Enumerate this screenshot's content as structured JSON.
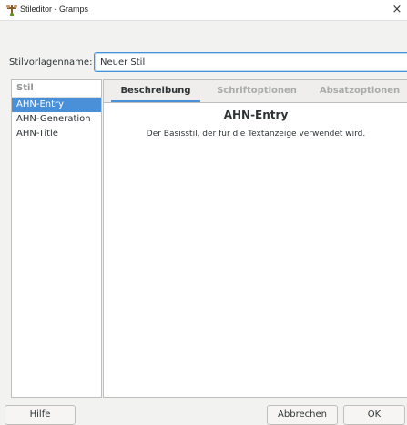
{
  "window": {
    "title": "Stileditor - Gramps",
    "close_glyph": "×"
  },
  "form": {
    "name_label": "Stilvorlagenname:",
    "name_value": "Neuer Stil"
  },
  "style_list": {
    "header": "Stil",
    "items": [
      {
        "label": "AHN-Entry",
        "selected": true
      },
      {
        "label": "AHN-Generation",
        "selected": false
      },
      {
        "label": "AHN-Title",
        "selected": false
      }
    ]
  },
  "tabs": [
    {
      "label": "Beschreibung",
      "active": true
    },
    {
      "label": "Schriftoptionen",
      "active": false
    },
    {
      "label": "Absatzoptionen",
      "active": false
    }
  ],
  "description": {
    "title": "AHN-Entry",
    "text": "Der Basisstil, der für die Textanzeige verwendet wird."
  },
  "buttons": {
    "help": "Hilfe",
    "cancel": "Abbrechen",
    "ok": "OK"
  },
  "colors": {
    "accent": "#4a90d9",
    "window_bg": "#f2f2f1",
    "list_bg": "#ffffff"
  },
  "icons": {
    "app": "gramps-tree-icon",
    "close": "close-icon"
  }
}
